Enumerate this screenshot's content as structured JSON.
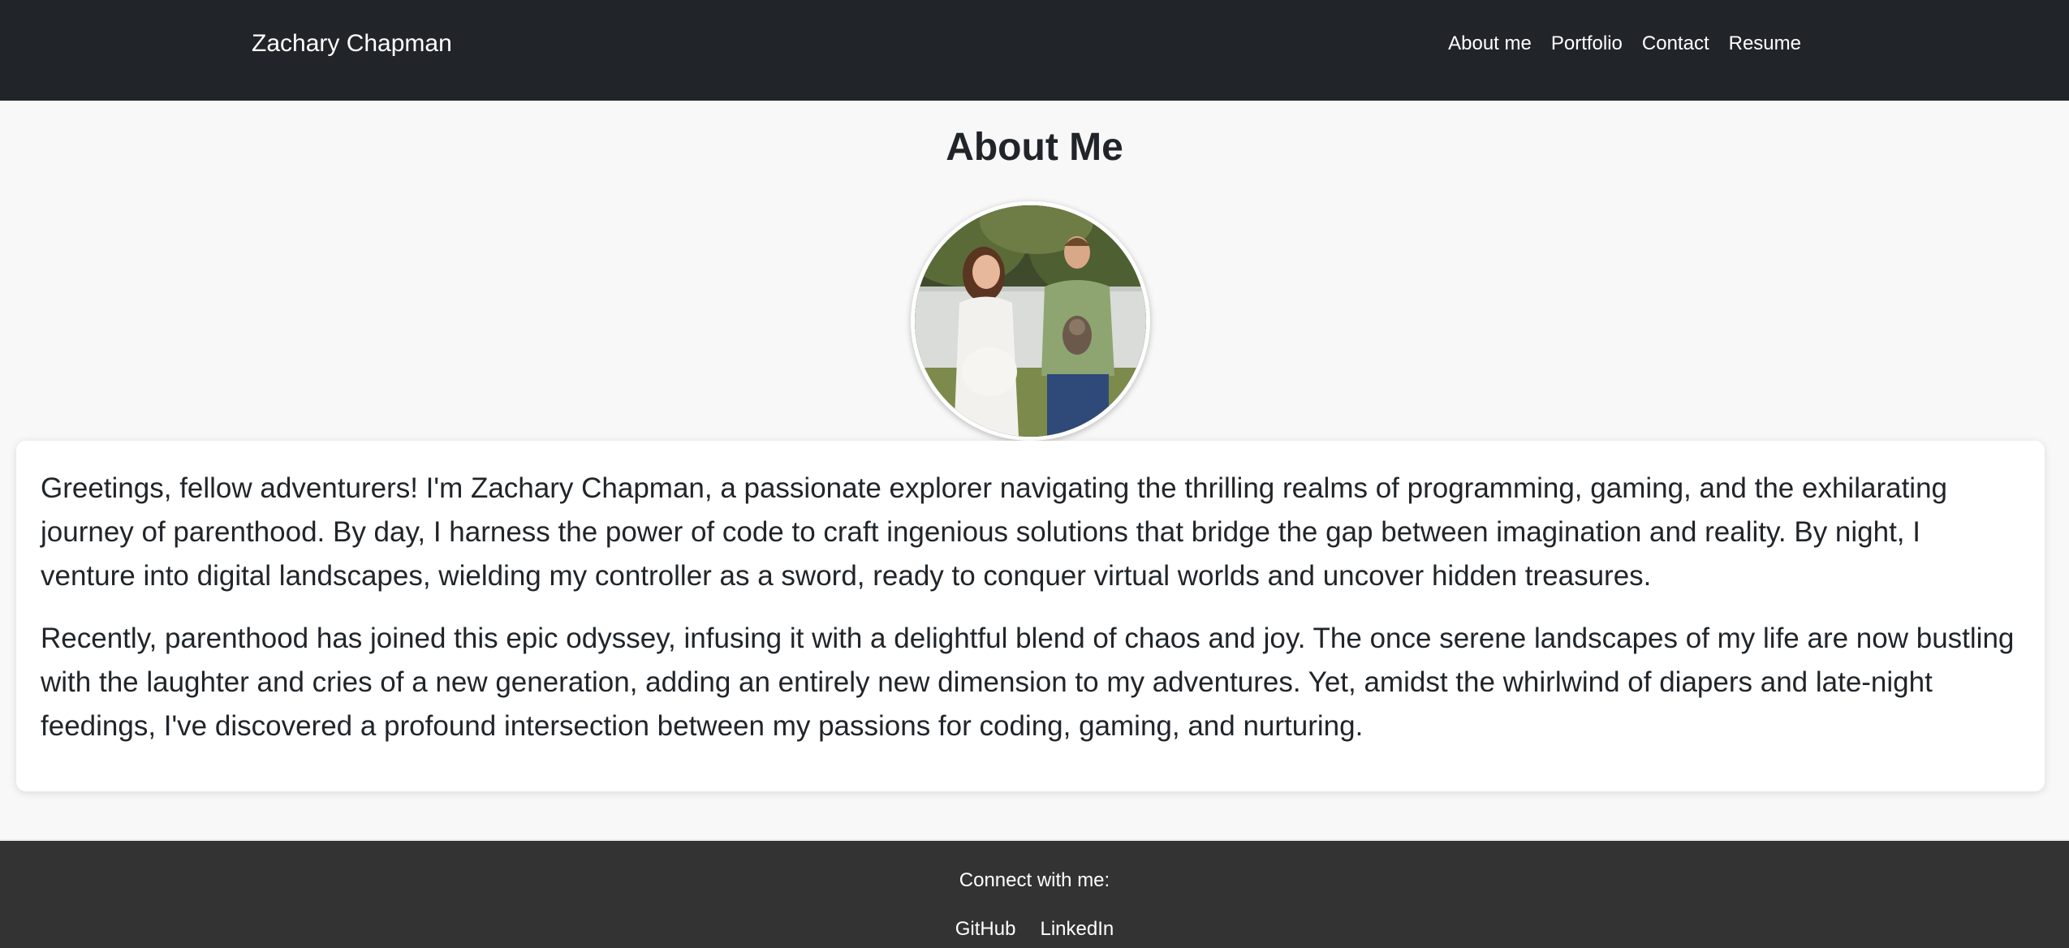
{
  "navbar": {
    "brand": "Zachary Chapman",
    "links": [
      {
        "label": "About me"
      },
      {
        "label": "Portfolio"
      },
      {
        "label": "Contact"
      },
      {
        "label": "Resume"
      }
    ]
  },
  "main": {
    "title": "About Me",
    "paragraphs": [
      "Greetings, fellow adventurers! I'm Zachary Chapman, a passionate explorer navigating the thrilling realms of programming, gaming, and the exhilarating journey of parenthood. By day, I harness the power of code to craft ingenious solutions that bridge the gap between imagination and reality. By night, I venture into digital landscapes, wielding my controller as a sword, ready to conquer virtual worlds and uncover hidden treasures.",
      "Recently, parenthood has joined this epic odyssey, infusing it with a delightful blend of chaos and joy. The once serene landscapes of my life are now bustling with the laughter and cries of a new generation, adding an entirely new dimension to my adventures. Yet, amidst the whirlwind of diapers and late-night feedings, I've discovered a profound intersection between my passions for coding, gaming, and nurturing."
    ]
  },
  "footer": {
    "connect_text": "Connect with me:",
    "links": [
      {
        "label": "GitHub"
      },
      {
        "label": "LinkedIn"
      }
    ]
  },
  "colors": {
    "navbar_bg": "#212529",
    "page_bg": "#f8f8f8",
    "footer_bg": "#333333",
    "text": "#212529",
    "nav_text": "#ffffff"
  }
}
